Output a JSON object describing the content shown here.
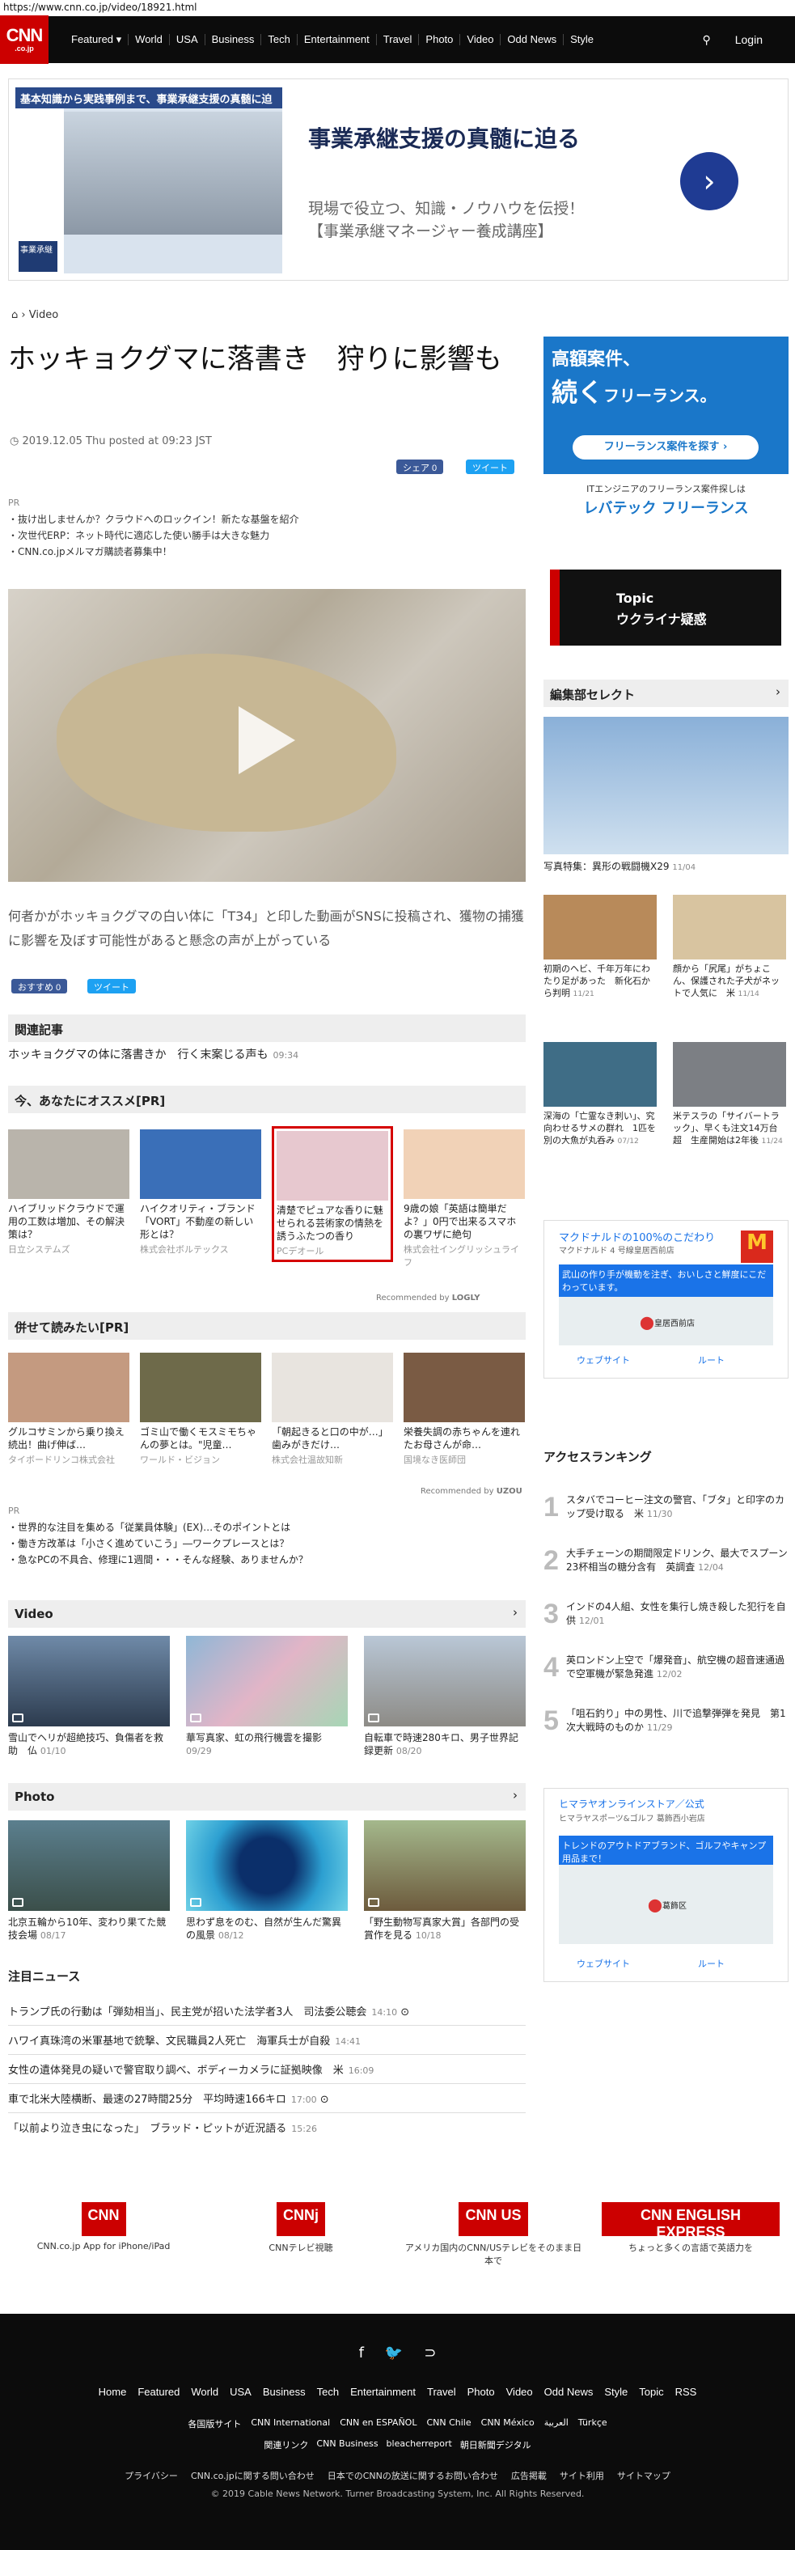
{
  "url": "https://www.cnn.co.jp/video/18921.html",
  "logo": {
    "big": "CNN",
    "small": ".co.jp"
  },
  "nav": [
    "Featured ▾",
    "World",
    "USA",
    "Business",
    "Tech",
    "Entertainment",
    "Travel",
    "Photo",
    "Video",
    "Odd News",
    "Style"
  ],
  "login": "Login",
  "ad": {
    "banner": "基本知識から実践事例まで、事業承継支援の真髄に迫る",
    "stamp": "事業承継",
    "headline": "事業承継支援の真髄に迫る",
    "body1": "現場で役立つ、知識・ノウハウを伝授！",
    "body2": "【事業承継マネージャー養成講座】",
    "go": "›"
  },
  "breadcrumb": "Video",
  "title": "ホッキョクグマに落書き　狩りに影響も",
  "date": "2019.12.05 Thu posted at 09:23 JST",
  "share": {
    "fb": "シェア 0",
    "tw": "ツイート"
  },
  "pr": {
    "label": "PR",
    "items": [
      "・抜け出しませんか？クラウドへのロックイン！新たな基盤を紹介",
      "・次世代ERP：ネット時代に適応した使い勝手は大きな魅力",
      "・CNN.co.jpメルマガ購読者募集中！"
    ]
  },
  "lead": "何者かがホッキョクグマの白い体に「T34」と印した動画がSNSに投稿され、獲物の捕獲に影響を及ぼす可能性があると懸念の声が上がっている",
  "share2": {
    "fb": "おすすめ 0",
    "tw": "ツイート"
  },
  "related": {
    "title": "関連記事",
    "item": "ホッキョクグマの体に落書きか　行く末案じる声も",
    "time": "09:34"
  },
  "recommend": {
    "title": "今、あなたにオススメ[PR]",
    "cards": [
      {
        "cap": "ハイブリッドクラウドで運用の工数は増加、その解決策は？",
        "src": "日立システムズ"
      },
      {
        "cap": "ハイクオリティ・ブランド「VORT」不動産の新しい形とは？",
        "src": "株式会社ボルテックス"
      },
      {
        "cap": "清楚でピュアな香りに魅せられる芸術家の情熱を誘うふたつの香り",
        "src": "PCデオール"
      },
      {
        "cap": "9歳の娘「英語は簡単だよ？」0円で出来るスマホの裏ワザに絶句",
        "src": "株式会社イングリッシュライフ"
      }
    ],
    "by": "Recommended by",
    "brand": "LOGLY"
  },
  "together": {
    "title": "併せて読みたい[PR]",
    "cards": [
      {
        "cap": "グルコサミンから乗り換え続出！曲げ伸ば…",
        "src": "タイボードリンコ株式会社"
      },
      {
        "cap": "ゴミ山で働くモスミモちゃんの夢とは。\"児童…",
        "src": "ワールド・ビジョン"
      },
      {
        "cap": "「朝起きると口の中が…」歯みがきだけ…",
        "src": "株式会社温故知新"
      },
      {
        "cap": "栄養失調の赤ちゃんを連れたお母さんが命…",
        "src": "国境なき医師団"
      }
    ],
    "by": "Recommended by",
    "brand": "UZOU"
  },
  "prlist": {
    "label": "PR",
    "items": [
      "・世界的な注目を集める「従業員体験」(EX)…そのポイントとは",
      "・働き方改革は「小さく進めていこう」―ワークプレースとは？",
      "・急なPCの不具合、修理に1週間・・・そんな経験、ありませんか？"
    ]
  },
  "videoSec": {
    "title": "Video",
    "items": [
      {
        "cap": "雪山でヘリが超絶技巧、負傷者を救助　仏",
        "d": "01/10"
      },
      {
        "cap": "華写真家、虹の飛行機雲を撮影",
        "d": "09/29"
      },
      {
        "cap": "自転車で時速280キロ、男子世界記録更新",
        "d": "08/20"
      }
    ]
  },
  "photoSec": {
    "title": "Photo",
    "items": [
      {
        "cap": "北京五輪から10年、変わり果てた競技会場",
        "d": "08/17"
      },
      {
        "cap": "思わず息をのむ、自然が生んだ驚異の風景",
        "d": "08/12"
      },
      {
        "cap": "「野生動物写真家大賞」各部門の受賞作を見る",
        "d": "10/18"
      }
    ]
  },
  "newsSec": {
    "title": "注目ニュース",
    "items": [
      {
        "t": "トランプ氏の行動は「弾劾相当」、民主党が招いた法学者3人　司法委公聴会",
        "d": "14:10"
      },
      {
        "t": "ハワイ真珠湾の米軍基地で銃撃、文民職員2人死亡　海軍兵士が自殺",
        "d": "14:41"
      },
      {
        "t": "女性の遺体発見の疑いで警官取り調べ、ボディーカメラに証拠映像　米",
        "d": "16:09"
      },
      {
        "t": "車で北米大陸横断、最速の27時間25分　平均時速166キロ",
        "d": "17:00"
      },
      {
        "t": "「以前より泣き虫になった」　ブラッド・ピットが近況語る",
        "d": "15:26"
      }
    ]
  },
  "side": {
    "adA": {
      "h1": "高額案件、",
      "h2": "続く",
      "h3": "フリーランス。",
      "btn": "フリーランス案件を探す ›",
      "sub": "ITエンジニアのフリーランス案件探しは",
      "brand": "レバテック フリーランス"
    },
    "topic": {
      "t1": "Topic",
      "t2": "ウクライナ疑惑"
    },
    "edit": {
      "title": "編集部セレクト",
      "main": "写真特集：異形の戦闘機X29",
      "mainD": "11/04",
      "items": [
        {
          "cap": "初期のヘビ、千年万年にわたり足があった　新化石から判明",
          "d": "11/21"
        },
        {
          "cap": "顔から「尻尾」がちょこん、保護された子犬がネットで人気に　米",
          "d": "11/14"
        },
        {
          "cap": "深海の「亡霊なき刺い」、究向わせるサメの群れ　1匹を別の大魚が丸呑み",
          "d": "07/12"
        },
        {
          "cap": "米テスラの「サイバートラック」、早くも注文14万台超　生産開始は2年後",
          "d": "11/24"
        }
      ]
    },
    "map1": {
      "title": "マクドナルドの100%のこだわり",
      "sub": "マクドナルド 4 号線皇居西前店",
      "box": "武山の作り手が機動を注ぎ、おいしさと鮮度にこだわっています。",
      "pin": "皇居西前店",
      "web": "ウェブサイト",
      "route": "ルート"
    },
    "rank": {
      "title": "アクセスランキング",
      "items": [
        {
          "t": "スタバでコーヒー注文の警官、「ブタ」と印字のカップ受け取る　米",
          "d": "11/30"
        },
        {
          "t": "大手チェーンの期間限定ドリンク、最大でスプーン23杯相当の糖分含有　英調査",
          "d": "12/04"
        },
        {
          "t": "インドの4人組、女性を集行し焼き殺した犯行を自供",
          "d": "12/01"
        },
        {
          "t": "英ロンドン上空で「爆発音」、航空機の超音速通過で空軍機が緊急発進",
          "d": "12/02"
        },
        {
          "t": "「咀石釣り」中の男性、川で追撃弾弾を発見　第1次大戦時のものか",
          "d": "11/29"
        }
      ]
    },
    "map2": {
      "title": "ヒマラヤオンラインストア／公式",
      "sub": "ヒマラヤスポーツ&ゴルフ 葛飾西小岩店",
      "box": "トレンドのアウトドアブランド、ゴルフやキャンプ用品まで！",
      "pin": "葛飾区",
      "web": "ウェブサイト",
      "route": "ルート"
    }
  },
  "apps": [
    {
      "lg": "CNN",
      "t": "CNN.co.jp App for iPhone/iPad"
    },
    {
      "lg": "CNNj",
      "t": "CNNテレビ視聴"
    },
    {
      "lg": "CNN US",
      "t": "アメリカ国内のCNN/USテレビをそのまま日本で"
    },
    {
      "lg": "CNN ENGLISH EXPRESS",
      "t": "ちょっと多くの言語で英語力を"
    }
  ],
  "footer": {
    "links": [
      "Home",
      "Featured",
      "World",
      "USA",
      "Business",
      "Tech",
      "Entertainment",
      "Travel",
      "Photo",
      "Video",
      "Odd News",
      "Style",
      "Topic",
      "RSS"
    ],
    "links2": [
      "各国版サイト",
      "CNN International",
      "CNN en ESPAÑOL",
      "CNN Chile",
      "CNN México",
      "العربية",
      "Türkçe"
    ],
    "links3": [
      "関連リンク",
      "CNN Business",
      "bleacherreport",
      "朝日新聞デジタル"
    ],
    "links4": [
      "プライバシー",
      "CNN.co.jpに関する問い合わせ",
      "日本でのCNNの放送に関するお問い合わせ",
      "広告掲載",
      "サイト利用",
      "サイトマップ"
    ],
    "copy": "© 2019 Cable News Network.  Turner Broadcasting System, Inc.  All Rights Reserved."
  }
}
